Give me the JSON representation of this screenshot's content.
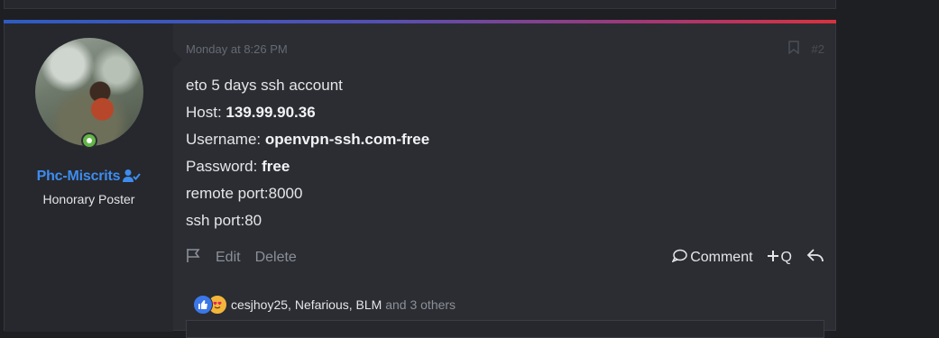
{
  "post": {
    "date": "Monday at 8:26 PM",
    "number": "#2",
    "author": {
      "name": "Phc-Miscrits",
      "title": "Honorary Poster",
      "online": true
    },
    "lines": [
      {
        "label": "eto 5 days ssh account",
        "value": ""
      },
      {
        "label": "Host: ",
        "value": "139.99.90.36"
      },
      {
        "label": "Username: ",
        "value": "openvpn-ssh.com-free"
      },
      {
        "label": "Password: ",
        "value": "free"
      },
      {
        "label": "remote port:8000",
        "value": ""
      },
      {
        "label": "ssh port:80",
        "value": ""
      }
    ],
    "actions_left": {
      "edit": "Edit",
      "delete": "Delete"
    },
    "actions_right": {
      "comment": "Comment",
      "quote": "Q"
    },
    "reactions": {
      "user1": "cesjhoy25",
      "sep1": ", ",
      "user2": "Nefarious",
      "sep2": ", ",
      "user3": "BLM",
      "others": " and 3 others"
    }
  },
  "colors": {
    "accent_blue": "#3e8cf0",
    "online_green": "#63b547",
    "gradient_start": "#2d5cc3",
    "gradient_end": "#d9323f"
  },
  "icons": [
    "report-flag-icon",
    "bookmark-icon",
    "comment-icon",
    "plus-icon",
    "reply-icon",
    "verified-user-icon",
    "like-reaction-icon",
    "love-reaction-icon"
  ]
}
